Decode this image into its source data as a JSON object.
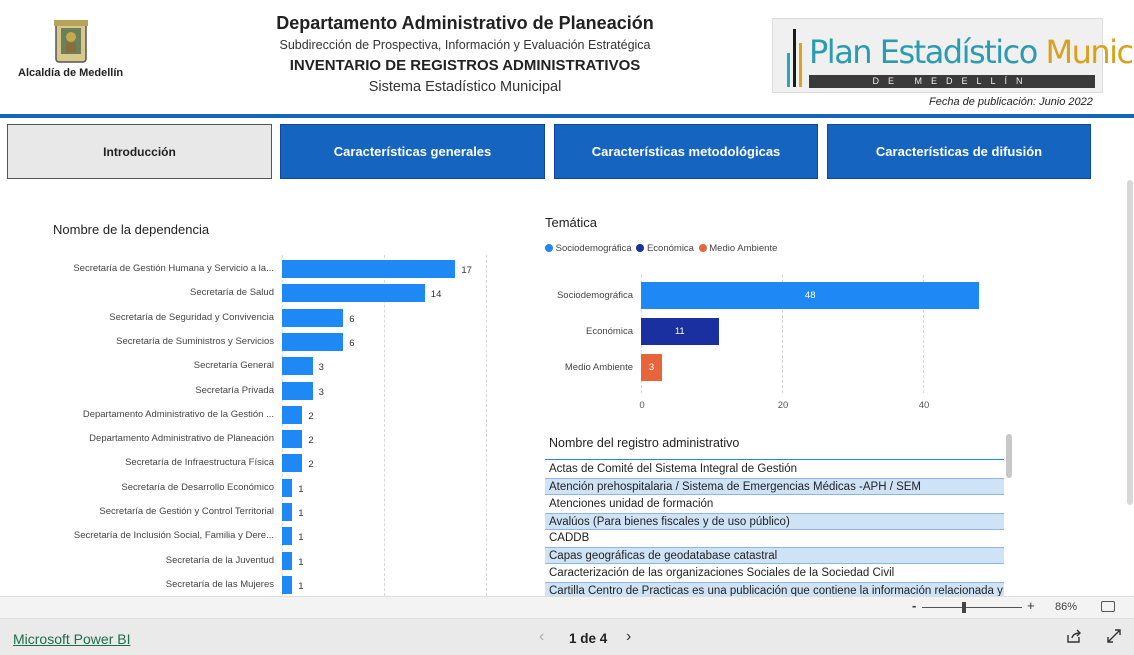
{
  "header": {
    "org_name": "Alcaldía de Medellín",
    "title": "Departamento Administrativo de Planeación",
    "subtitle": "Subdirección de Prospectiva, Información y Evaluación Estratégica",
    "heading": "INVENTARIO DE REGISTROS ADMINISTRATIVOS",
    "system": "Sistema Estadístico Municipal",
    "logo_text_1": "Plan Estadístico",
    "logo_text_2": "Municipal",
    "logo_sub": "DE MEDELLÍN",
    "pub_date": "Fecha de publicación: Junio 2022"
  },
  "nav": {
    "intro": "Introducción",
    "general": "Características generales",
    "method": "Características metodológicas",
    "diffusion": "Características de difusión"
  },
  "chart_data": [
    {
      "type": "bar",
      "title": "Nombre de la dependencia",
      "categories": [
        "Secretaría de Gestión Humana y Servicio a la...",
        "Secretaría de Salud",
        "Secretaría de Seguridad y Convivencia",
        "Secretaría de Suministros y Servicios",
        "Secretaría General",
        "Secretaría Privada",
        "Departamento Administrativo de la Gestión ...",
        "Departamento Administrativo de Planeación",
        "Secretaría de Infraestructura Física",
        "Secretaría de Desarrollo Económico",
        "Secretaría de Gestión y Control Territorial",
        "Secretaría de Inclusión Social, Familia y Dere...",
        "Secretaría de la Juventud",
        "Secretaría de las Mujeres"
      ],
      "values": [
        17,
        14,
        6,
        6,
        3,
        3,
        2,
        2,
        2,
        1,
        1,
        1,
        1,
        1
      ],
      "xlim": [
        0,
        20
      ],
      "color": "#1e88f5"
    },
    {
      "type": "bar",
      "title": "Temática",
      "legend": [
        "Sociodemográfica",
        "Económica",
        "Medio Ambiente"
      ],
      "legend_position": "top-left",
      "categories": [
        "Sociodemográfica",
        "Económica",
        "Medio Ambiente"
      ],
      "values": [
        48,
        11,
        3
      ],
      "colors": [
        "#1e88f5",
        "#1a2fa0",
        "#e8643a"
      ],
      "xticks": [
        "0",
        "20",
        "40"
      ],
      "xlim": [
        0,
        50
      ]
    }
  ],
  "table": {
    "header": "Nombre del registro administrativo",
    "rows": [
      "Actas de Comité del Sistema Integral de Gestión",
      "Atención prehospitalaria / Sistema de Emergencias Médicas -APH / SEM",
      "Atenciones unidad de formación",
      "Avalúos (Para bienes fiscales y de uso público)",
      "CADDB",
      "Capas geográficas de geodatabase catastral",
      "Caracterización de las organizaciones Sociales de la Sociedad Civil",
      "Cartilla Centro de Practicas es una publicación que contiene la información relacionada y"
    ]
  },
  "zoom": {
    "minus": "-",
    "plus": "+",
    "value": "86%"
  },
  "footer": {
    "brand": "Microsoft Power BI",
    "page": "1 de 4"
  }
}
